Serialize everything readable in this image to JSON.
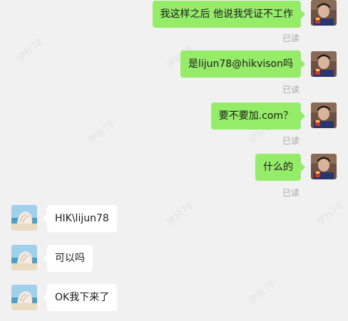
{
  "watermark": "伊秋78",
  "messages": [
    {
      "side": "out",
      "text": "我这样之后 他说我凭证不工作",
      "status": "已读"
    },
    {
      "side": "out",
      "text": "是lijun78@hikvison吗",
      "status": "已读"
    },
    {
      "side": "out",
      "text": "要不要加.com？",
      "status": "已读"
    },
    {
      "side": "out",
      "text": "什么的",
      "status": "已读"
    },
    {
      "side": "in",
      "text": "HIK\\lijun78"
    },
    {
      "side": "in",
      "text": "可以吗"
    },
    {
      "side": "in",
      "text": "OK我下来了"
    }
  ],
  "colors": {
    "background": "#f1f1f1",
    "outgoing_bubble": "#95ec69",
    "incoming_bubble": "#ffffff",
    "read_status": "#a8a8a8"
  },
  "icons": {
    "self_avatar": "person-photo-avatar",
    "contact_avatar": "shell-beach-avatar"
  }
}
